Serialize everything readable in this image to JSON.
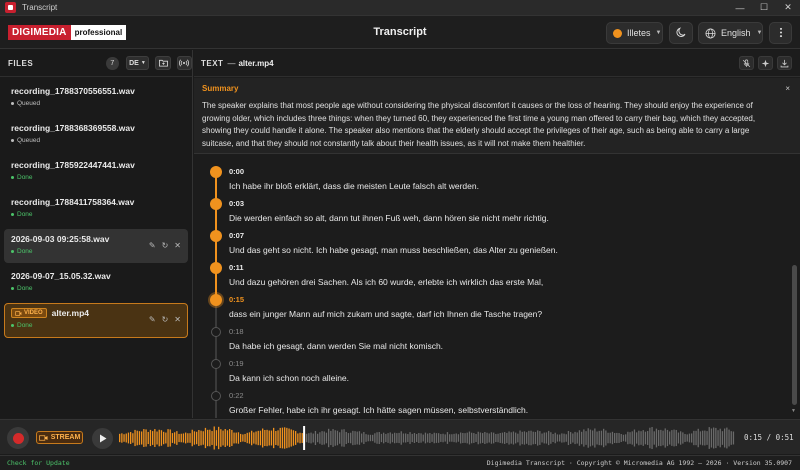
{
  "window": {
    "title": "Transcript",
    "controls": [
      "—",
      "☐",
      "✕"
    ]
  },
  "header": {
    "logo_brand": "DIGIMEDIA",
    "logo_edition": "professional",
    "title": "Transcript",
    "voice_label": "Illetes",
    "language_label": "English",
    "icons": [
      "moon-icon",
      "globe-icon",
      "more-vertical-icon"
    ],
    "accent_color": "#f0921e"
  },
  "sidebar": {
    "title": "FILES",
    "count": "7",
    "language_filter": "DE",
    "files": [
      {
        "name": "recording_1788370556551.wav",
        "status": "Queued",
        "state": "queued"
      },
      {
        "name": "recording_1788368369558.wav",
        "status": "Queued",
        "state": "queued"
      },
      {
        "name": "recording_1785922447441.wav",
        "status": "Done",
        "state": "done"
      },
      {
        "name": "recording_1788411758364.wav",
        "status": "Done",
        "state": "done"
      },
      {
        "name": "2026-09-03 09:25:58.wav",
        "status": "Done",
        "state": "done"
      },
      {
        "name": "2026-09-07_15.05.32.wav",
        "status": "Done",
        "state": "done"
      },
      {
        "name": "alter.mp4",
        "status": "Done",
        "state": "done",
        "badge": "VIDEO"
      }
    ]
  },
  "main": {
    "label": "TEXT",
    "dash": "—",
    "current_file": "alter.mp4",
    "summary": {
      "title": "Summary",
      "text": "The speaker explains that most people age without considering the physical discomfort it causes or the loss of hearing. They should enjoy the experience of growing older, which includes three things: when they turned 60, they experienced the first time a young man offered to carry their bag, which they accepted, showing they could handle it alone. The speaker also mentions that the elderly should accept the privileges of their age, such as being able to carry a large suitcase, and that they should not constantly talk about their health issues, as it will not make them healthier.",
      "close": "×"
    },
    "segments": [
      {
        "time": "0:00",
        "text": "Ich habe ihr bloß erklärt, dass die meisten Leute falsch alt werden.",
        "state": "past"
      },
      {
        "time": "0:03",
        "text": "Die werden einfach so alt, dann tut ihnen Fuß weh, dann hören sie nicht mehr richtig.",
        "state": "past"
      },
      {
        "time": "0:07",
        "text": "Und das geht so nicht. Ich habe gesagt, man muss beschließen, das Alter zu genießen.",
        "state": "past"
      },
      {
        "time": "0:11",
        "text": "Und dazu gehören drei Sachen. Als ich 60 wurde, erlebte ich wirklich das erste Mal,",
        "state": "past"
      },
      {
        "time": "0:15",
        "text": "dass ein junger Mann auf mich zukam und sagte, darf ich Ihnen die Tasche tragen?",
        "state": "current"
      },
      {
        "time": "0:18",
        "text": "Da habe ich gesagt, dann werden Sie mal nicht komisch.",
        "state": "future"
      },
      {
        "time": "0:19",
        "text": "Da kann ich schon noch alleine.",
        "state": "future"
      },
      {
        "time": "0:22",
        "text": "Großer Fehler, habe ich ihr gesagt. Ich hätte sagen müssen, selbstverständlich.",
        "state": "future"
      }
    ]
  },
  "player": {
    "stream_label": "STREAM",
    "time": "0:15 / 0:51",
    "progress": 0.3,
    "played_color": "#f0921e",
    "unplayed_color": "#6a6a6a"
  },
  "statusbar": {
    "check_update": "Check for Update",
    "copyright": "Digimedia Transcript · Copyright © Micromedia AG 1992 – 2026 · Version 35.0907"
  }
}
